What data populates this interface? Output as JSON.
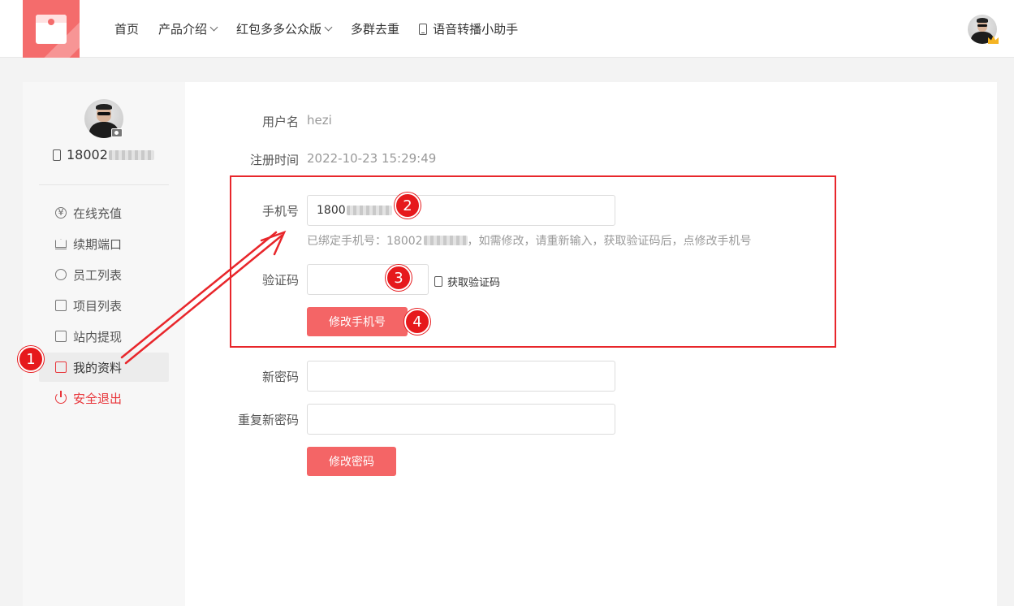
{
  "header": {
    "nav": [
      {
        "label": "首页",
        "has_dropdown": false
      },
      {
        "label": "产品介绍",
        "has_dropdown": true
      },
      {
        "label": "红包多多公众版",
        "has_dropdown": true
      },
      {
        "label": "多群去重",
        "has_dropdown": false
      },
      {
        "label": "语音转播小助手",
        "has_dropdown": false,
        "icon": "phone-icon"
      }
    ]
  },
  "sidebar": {
    "phone_prefix": "18002",
    "menu": [
      {
        "label": "在线充值",
        "icon": "yuan-icon"
      },
      {
        "label": "续期端口",
        "icon": "crown-icon"
      },
      {
        "label": "员工列表",
        "icon": "staff-icon"
      },
      {
        "label": "项目列表",
        "icon": "clipboard-icon"
      },
      {
        "label": "站内提现",
        "icon": "ticket-icon"
      },
      {
        "label": "我的资料",
        "icon": "profile-card-icon",
        "active": true
      },
      {
        "label": "安全退出",
        "icon": "power-icon",
        "danger": true
      }
    ]
  },
  "profile": {
    "username_label": "用户名",
    "username": "hezi",
    "register_label": "注册时间",
    "register_time": "2022-10-23 15:29:49",
    "phone_label": "手机号",
    "phone_value": "1800",
    "phone_hint_prefix": "已绑定手机号：18002",
    "phone_hint_suffix": "，如需修改，请重新输入，获取验证码后，点修改手机号",
    "code_label": "验证码",
    "code_value": "",
    "get_code": "获取验证码",
    "change_phone_button": "修改手机号",
    "new_password_label": "新密码",
    "repeat_password_label": "重复新密码",
    "change_password_button": "修改密码"
  },
  "annotations": {
    "markers": [
      "1",
      "2",
      "3",
      "4"
    ],
    "color": "#e6191c"
  },
  "colors": {
    "brand": "#f46c6c",
    "button": "#f46566",
    "danger": "#e8353a"
  }
}
